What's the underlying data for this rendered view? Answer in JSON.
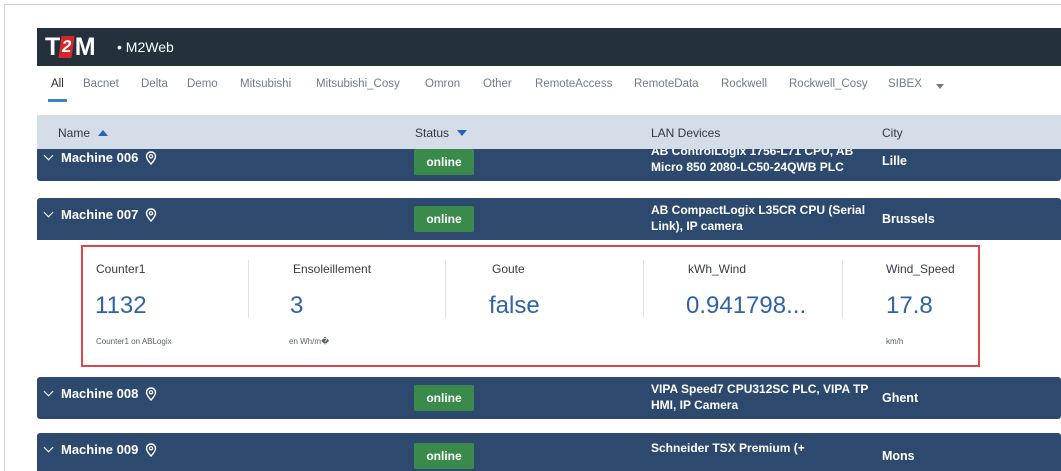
{
  "app": {
    "logo_text": "T2M",
    "title": "• M2Web"
  },
  "tabs": [
    {
      "label": "All",
      "active": true
    },
    {
      "label": "Bacnet"
    },
    {
      "label": "Delta"
    },
    {
      "label": "Demo"
    },
    {
      "label": "Mitsubishi"
    },
    {
      "label": "Mitsubishi_Cosy"
    },
    {
      "label": "Omron"
    },
    {
      "label": "Other"
    },
    {
      "label": "RemoteAccess"
    },
    {
      "label": "RemoteData"
    },
    {
      "label": "Rockwell"
    },
    {
      "label": "Rockwell_Cosy"
    },
    {
      "label": "SIBEX"
    }
  ],
  "columns": {
    "name": "Name",
    "status": "Status",
    "lan": "LAN Devices",
    "city": "City"
  },
  "machines": [
    {
      "name": "Machine 006",
      "status": "online",
      "lan": "AB ControlLogix 1756-L71 CPU, AB Micro 850 2080-LC50-24QWB PLC",
      "city": "Lille"
    },
    {
      "name": "Machine 007",
      "status": "online",
      "lan": "AB CompactLogix L35CR CPU (Serial Link), IP camera",
      "city": "Brussels"
    },
    {
      "name": "Machine 008",
      "status": "online",
      "lan": "VIPA Speed7 CPU312SC PLC, VIPA TP HMI, IP Camera",
      "city": "Ghent"
    },
    {
      "name": "Machine 009",
      "status": "online",
      "lan": "Schneider TSX Premium (+",
      "city": "Mons"
    }
  ],
  "metrics": [
    {
      "label": "Counter1",
      "value": "1132",
      "sub": "Counter1 on ABLogix"
    },
    {
      "label": "Ensoleillement",
      "value": "3",
      "sub": "en Wh/m�"
    },
    {
      "label": "Goute",
      "value": "false",
      "sub": ""
    },
    {
      "label": "kWh_Wind",
      "value": "0.941798...",
      "sub": ""
    },
    {
      "label": "Wind_Speed",
      "value": "17.8",
      "sub": "km/h"
    }
  ],
  "colors": {
    "topbar": "#24303c",
    "row": "#2d4a6e",
    "online": "#3a8a4c",
    "value": "#2f63a8",
    "highlight": "#e0454a"
  }
}
